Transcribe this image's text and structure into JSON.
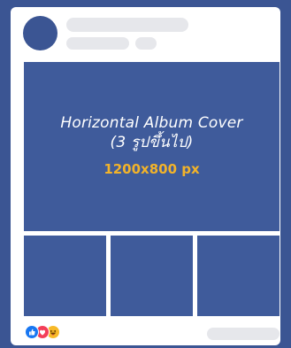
{
  "post": {
    "cover_title_line1": "Horizontal Album Cover",
    "cover_title_line2": "(3 รูปขึ้นไป)",
    "cover_size": "1200x800 px"
  },
  "reactions": [
    "like-icon",
    "love-icon",
    "haha-icon"
  ],
  "colors": {
    "background": "#3b5593",
    "card": "#ffffff",
    "placeholder_image": "#3f5b9b",
    "skeleton": "#e6e7eb",
    "size_text": "#f2b32a",
    "like": "#1877f2",
    "love": "#f33e58",
    "haha": "#f7b928"
  }
}
